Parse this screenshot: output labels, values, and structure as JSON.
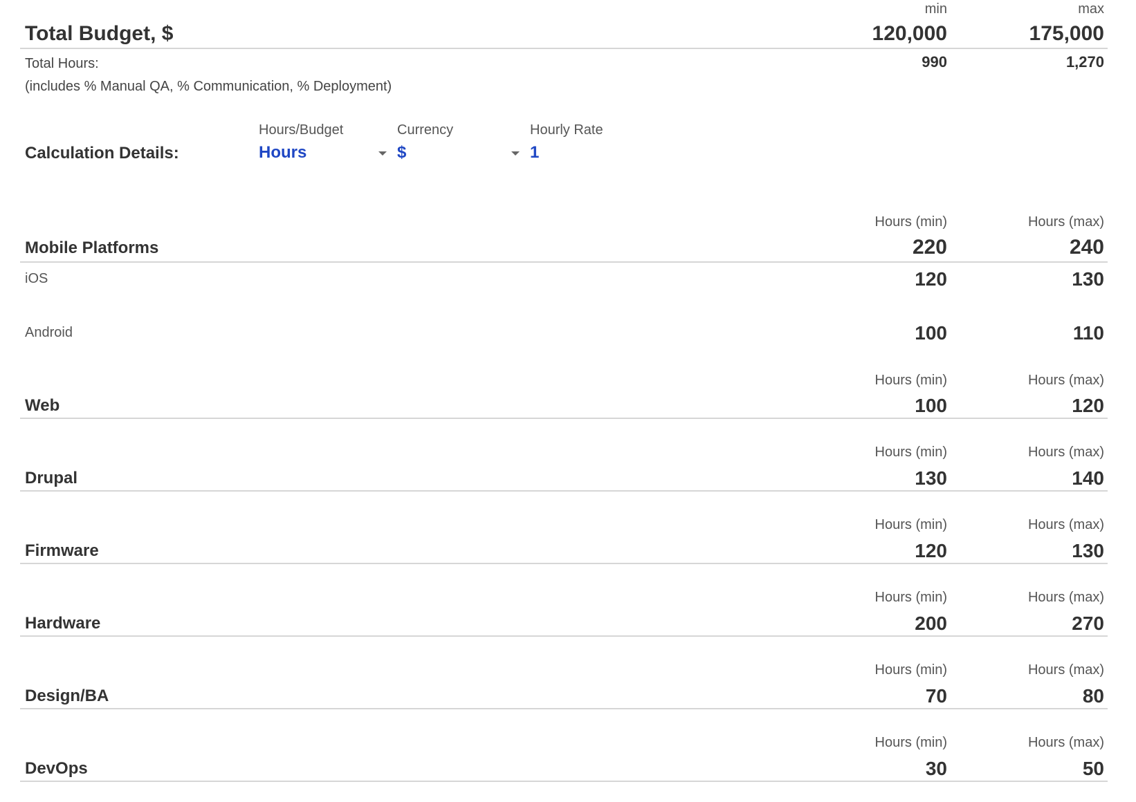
{
  "summary": {
    "min_header": "min",
    "max_header": "max",
    "title": "Total Budget, $",
    "budget_min": "120,000",
    "budget_max": "175,000",
    "total_hours_label": "Total Hours:",
    "hours_min": "990",
    "hours_max": "1,270",
    "note": "(includes % Manual QA, % Communication, % Deployment)"
  },
  "calculation": {
    "label": "Calculation Details:",
    "hours_budget": {
      "caption": "Hours/Budget",
      "value": "Hours"
    },
    "currency": {
      "caption": "Currency",
      "value": "$"
    },
    "hourly_rate": {
      "caption": "Hourly Rate",
      "value": "1"
    }
  },
  "column_headers": {
    "min": "Hours (min)",
    "max": "Hours (max)"
  },
  "sections": [
    {
      "title": "Mobile Platforms",
      "min": "220",
      "max": "240",
      "rows": [
        {
          "label": "iOS",
          "min": "120",
          "max": "130"
        },
        {
          "label": "Android",
          "min": "100",
          "max": "110"
        }
      ]
    },
    {
      "title": "Web",
      "min": "100",
      "max": "120"
    },
    {
      "title": "Drupal",
      "min": "130",
      "max": "140"
    },
    {
      "title": "Firmware",
      "min": "120",
      "max": "130"
    },
    {
      "title": "Hardware",
      "min": "200",
      "max": "270"
    },
    {
      "title": "Design/BA",
      "min": "70",
      "max": "80"
    },
    {
      "title": "DevOps",
      "min": "30",
      "max": "50"
    }
  ],
  "icons": {
    "dropdown": "chevron-down-icon"
  },
  "colors": {
    "accent": "#1f47c4",
    "text": "#333333",
    "rule": "#d6d6d6"
  }
}
